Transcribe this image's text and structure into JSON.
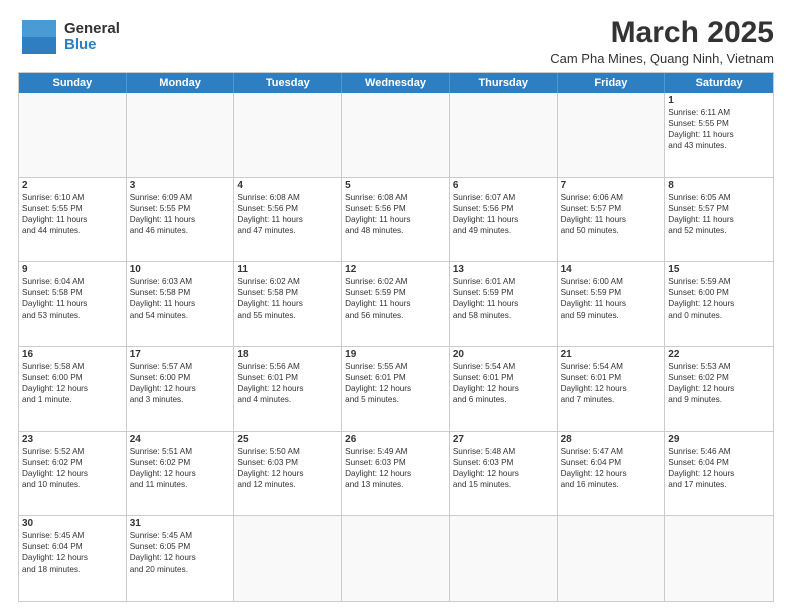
{
  "header": {
    "logo_general": "General",
    "logo_blue": "Blue",
    "title": "March 2025",
    "subtitle": "Cam Pha Mines, Quang Ninh, Vietnam"
  },
  "weekdays": [
    "Sunday",
    "Monday",
    "Tuesday",
    "Wednesday",
    "Thursday",
    "Friday",
    "Saturday"
  ],
  "weeks": [
    [
      {
        "day": "",
        "empty": true
      },
      {
        "day": "",
        "empty": true
      },
      {
        "day": "",
        "empty": true
      },
      {
        "day": "",
        "empty": true
      },
      {
        "day": "",
        "empty": true
      },
      {
        "day": "",
        "empty": true
      },
      {
        "day": "1",
        "info": "Sunrise: 6:11 AM\nSunset: 5:55 PM\nDaylight: 11 hours\nand 43 minutes."
      }
    ],
    [
      {
        "day": "2",
        "info": "Sunrise: 6:10 AM\nSunset: 5:55 PM\nDaylight: 11 hours\nand 44 minutes."
      },
      {
        "day": "3",
        "info": "Sunrise: 6:09 AM\nSunset: 5:55 PM\nDaylight: 11 hours\nand 46 minutes."
      },
      {
        "day": "4",
        "info": "Sunrise: 6:08 AM\nSunset: 5:56 PM\nDaylight: 11 hours\nand 47 minutes."
      },
      {
        "day": "5",
        "info": "Sunrise: 6:08 AM\nSunset: 5:56 PM\nDaylight: 11 hours\nand 48 minutes."
      },
      {
        "day": "6",
        "info": "Sunrise: 6:07 AM\nSunset: 5:56 PM\nDaylight: 11 hours\nand 49 minutes."
      },
      {
        "day": "7",
        "info": "Sunrise: 6:06 AM\nSunset: 5:57 PM\nDaylight: 11 hours\nand 50 minutes."
      },
      {
        "day": "8",
        "info": "Sunrise: 6:05 AM\nSunset: 5:57 PM\nDaylight: 11 hours\nand 52 minutes."
      }
    ],
    [
      {
        "day": "9",
        "info": "Sunrise: 6:04 AM\nSunset: 5:58 PM\nDaylight: 11 hours\nand 53 minutes."
      },
      {
        "day": "10",
        "info": "Sunrise: 6:03 AM\nSunset: 5:58 PM\nDaylight: 11 hours\nand 54 minutes."
      },
      {
        "day": "11",
        "info": "Sunrise: 6:02 AM\nSunset: 5:58 PM\nDaylight: 11 hours\nand 55 minutes."
      },
      {
        "day": "12",
        "info": "Sunrise: 6:02 AM\nSunset: 5:59 PM\nDaylight: 11 hours\nand 56 minutes."
      },
      {
        "day": "13",
        "info": "Sunrise: 6:01 AM\nSunset: 5:59 PM\nDaylight: 11 hours\nand 58 minutes."
      },
      {
        "day": "14",
        "info": "Sunrise: 6:00 AM\nSunset: 5:59 PM\nDaylight: 11 hours\nand 59 minutes."
      },
      {
        "day": "15",
        "info": "Sunrise: 5:59 AM\nSunset: 6:00 PM\nDaylight: 12 hours\nand 0 minutes."
      }
    ],
    [
      {
        "day": "16",
        "info": "Sunrise: 5:58 AM\nSunset: 6:00 PM\nDaylight: 12 hours\nand 1 minute."
      },
      {
        "day": "17",
        "info": "Sunrise: 5:57 AM\nSunset: 6:00 PM\nDaylight: 12 hours\nand 3 minutes."
      },
      {
        "day": "18",
        "info": "Sunrise: 5:56 AM\nSunset: 6:01 PM\nDaylight: 12 hours\nand 4 minutes."
      },
      {
        "day": "19",
        "info": "Sunrise: 5:55 AM\nSunset: 6:01 PM\nDaylight: 12 hours\nand 5 minutes."
      },
      {
        "day": "20",
        "info": "Sunrise: 5:54 AM\nSunset: 6:01 PM\nDaylight: 12 hours\nand 6 minutes."
      },
      {
        "day": "21",
        "info": "Sunrise: 5:54 AM\nSunset: 6:01 PM\nDaylight: 12 hours\nand 7 minutes."
      },
      {
        "day": "22",
        "info": "Sunrise: 5:53 AM\nSunset: 6:02 PM\nDaylight: 12 hours\nand 9 minutes."
      }
    ],
    [
      {
        "day": "23",
        "info": "Sunrise: 5:52 AM\nSunset: 6:02 PM\nDaylight: 12 hours\nand 10 minutes."
      },
      {
        "day": "24",
        "info": "Sunrise: 5:51 AM\nSunset: 6:02 PM\nDaylight: 12 hours\nand 11 minutes."
      },
      {
        "day": "25",
        "info": "Sunrise: 5:50 AM\nSunset: 6:03 PM\nDaylight: 12 hours\nand 12 minutes."
      },
      {
        "day": "26",
        "info": "Sunrise: 5:49 AM\nSunset: 6:03 PM\nDaylight: 12 hours\nand 13 minutes."
      },
      {
        "day": "27",
        "info": "Sunrise: 5:48 AM\nSunset: 6:03 PM\nDaylight: 12 hours\nand 15 minutes."
      },
      {
        "day": "28",
        "info": "Sunrise: 5:47 AM\nSunset: 6:04 PM\nDaylight: 12 hours\nand 16 minutes."
      },
      {
        "day": "29",
        "info": "Sunrise: 5:46 AM\nSunset: 6:04 PM\nDaylight: 12 hours\nand 17 minutes."
      }
    ],
    [
      {
        "day": "30",
        "info": "Sunrise: 5:45 AM\nSunset: 6:04 PM\nDaylight: 12 hours\nand 18 minutes."
      },
      {
        "day": "31",
        "info": "Sunrise: 5:45 AM\nSunset: 6:05 PM\nDaylight: 12 hours\nand 20 minutes."
      },
      {
        "day": "",
        "empty": true
      },
      {
        "day": "",
        "empty": true
      },
      {
        "day": "",
        "empty": true
      },
      {
        "day": "",
        "empty": true
      },
      {
        "day": "",
        "empty": true
      }
    ]
  ]
}
